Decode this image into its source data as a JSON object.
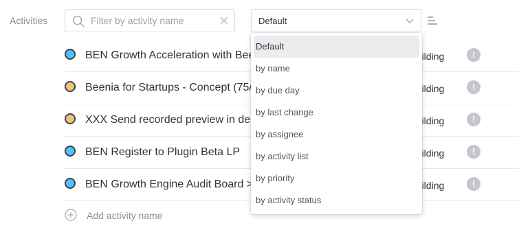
{
  "header": {
    "label": "Activities",
    "filter": {
      "placeholder": "Filter by activity name",
      "value": ""
    },
    "sort": {
      "selected": "Default"
    }
  },
  "colors": {
    "blue_status": "#4fc3f7",
    "orange_status": "#f5c27a"
  },
  "activities": [
    {
      "name": "BEN Growth Acceleration with Beenia",
      "status_color": "#4fc3f7",
      "status": "building"
    },
    {
      "name": "Beenia for Startups - Concept (75/",
      "status_color": "#f5c27a",
      "status": "building"
    },
    {
      "name": "XXX Send recorded preview in demo",
      "status_color": "#f5c27a",
      "status": "building"
    },
    {
      "name": "BEN Register to Plugin Beta LP",
      "status_color": "#4fc3f7",
      "status": "building"
    },
    {
      "name": "BEN Growth Engine Audit Board > ",
      "status_color": "#4fc3f7",
      "status": "building"
    }
  ],
  "add_activity": {
    "label": "Add activity name"
  },
  "dropdown": {
    "options": [
      "Default",
      "by name",
      "by due day",
      "by last change",
      "by assignee",
      "by activity list",
      "by priority",
      "by activity status"
    ],
    "selected_index": 0
  },
  "icons": {
    "search": "search-icon",
    "clear": "close-icon",
    "chevron": "chevron-down-icon",
    "view": "lines-icon",
    "add": "plus-circle-icon",
    "alert": "exclamation-icon"
  }
}
